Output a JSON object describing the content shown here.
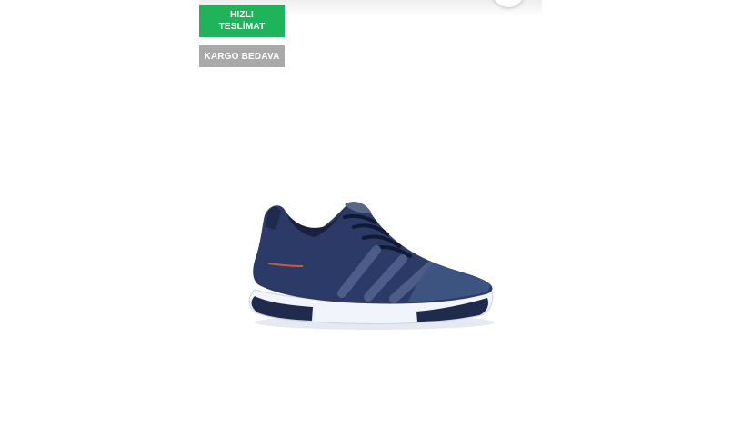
{
  "badges": {
    "fast_delivery_line1": "HIZLI",
    "fast_delivery_line2": "TESLİMAT",
    "free_shipping": "KARGO BEDAVA"
  },
  "product_image": {
    "icon": "sneaker-image",
    "colors": {
      "upper": "#2b3a66",
      "upper_dark": "#1f2a4d",
      "sole": "#f2f4fb",
      "accent": "#c85a3a"
    }
  },
  "favorite_button": {
    "icon": "heart-icon"
  },
  "colors": {
    "fast_delivery": "#1fb35a",
    "free_shipping": "#a9a9a9"
  }
}
